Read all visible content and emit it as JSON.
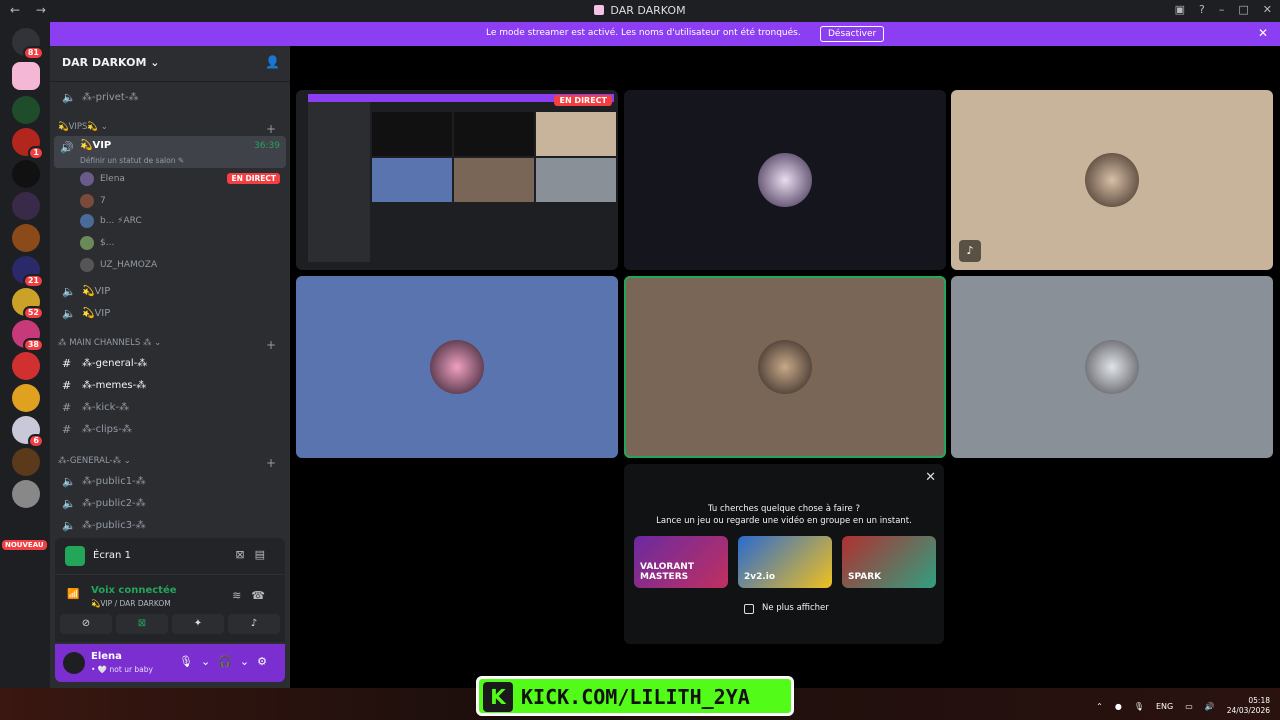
{
  "window": {
    "title": "DAR DARKOM",
    "nav": "← →"
  },
  "banner": {
    "text": "Le mode streamer est activé. Les noms d'utilisateur ont été tronqués.",
    "button": "Désactiver"
  },
  "rail": {
    "badges": [
      "81",
      "1",
      "21",
      "52",
      "38",
      "6"
    ],
    "new_label": "NOUVEAU"
  },
  "guild": {
    "name": "DAR DARKOM ⌄"
  },
  "channels": {
    "privet": "⁂-privet-⁂",
    "cat_vips": "💫VIPS💫 ⌄",
    "active": {
      "name": "💫VIP",
      "time": "36:39",
      "status": "Définir un statut de salon ✎"
    },
    "users": [
      {
        "name": "Elena",
        "live": "EN DIRECT"
      },
      {
        "name": "7"
      },
      {
        "name": "b...   ⚡ARC"
      },
      {
        "name": "$..."
      },
      {
        "name": "UZ_HAMOZA"
      }
    ],
    "vip2": "💫VIP",
    "vip3": "💫VIP",
    "cat_main": "⁂ MAIN CHANNELS ⁂ ⌄",
    "general": "⁂-general-⁂",
    "memes": "⁂-memes-⁂",
    "kick": "⁂-kick-⁂",
    "clips": "⁂-clips-⁂",
    "cat_general": "⁂-GENERAL-⁂ ⌄",
    "public1": "⁂-public1-⁂",
    "public2": "⁂-public2-⁂",
    "public3": "⁂-public3-⁂"
  },
  "screen_panel": {
    "label": "Écran 1"
  },
  "voice": {
    "status": "Voix connectée",
    "location": "💫VIP / DAR DARKOM"
  },
  "user": {
    "name": "Elena",
    "status": "• 🤍 not ur baby"
  },
  "call": {
    "live_label": "EN DIRECT"
  },
  "activity": {
    "question": "Tu cherches quelque chose à faire ?",
    "prompt": "Lance un jeu ou regarde une vidéo en groupe en un instant.",
    "cards": [
      "VALORANT MASTERS",
      "2v2.io",
      "SPARK"
    ],
    "dont_show": "Ne plus afficher"
  },
  "kick_overlay": {
    "text": "KICK.COM/LILITH_2YA"
  },
  "tray": {
    "lang": "ENG",
    "time": "05:18",
    "date": "24/03/2026"
  },
  "colors": {
    "accent": "#8c3ff2",
    "green": "#23a55a",
    "red": "#f23f43"
  }
}
